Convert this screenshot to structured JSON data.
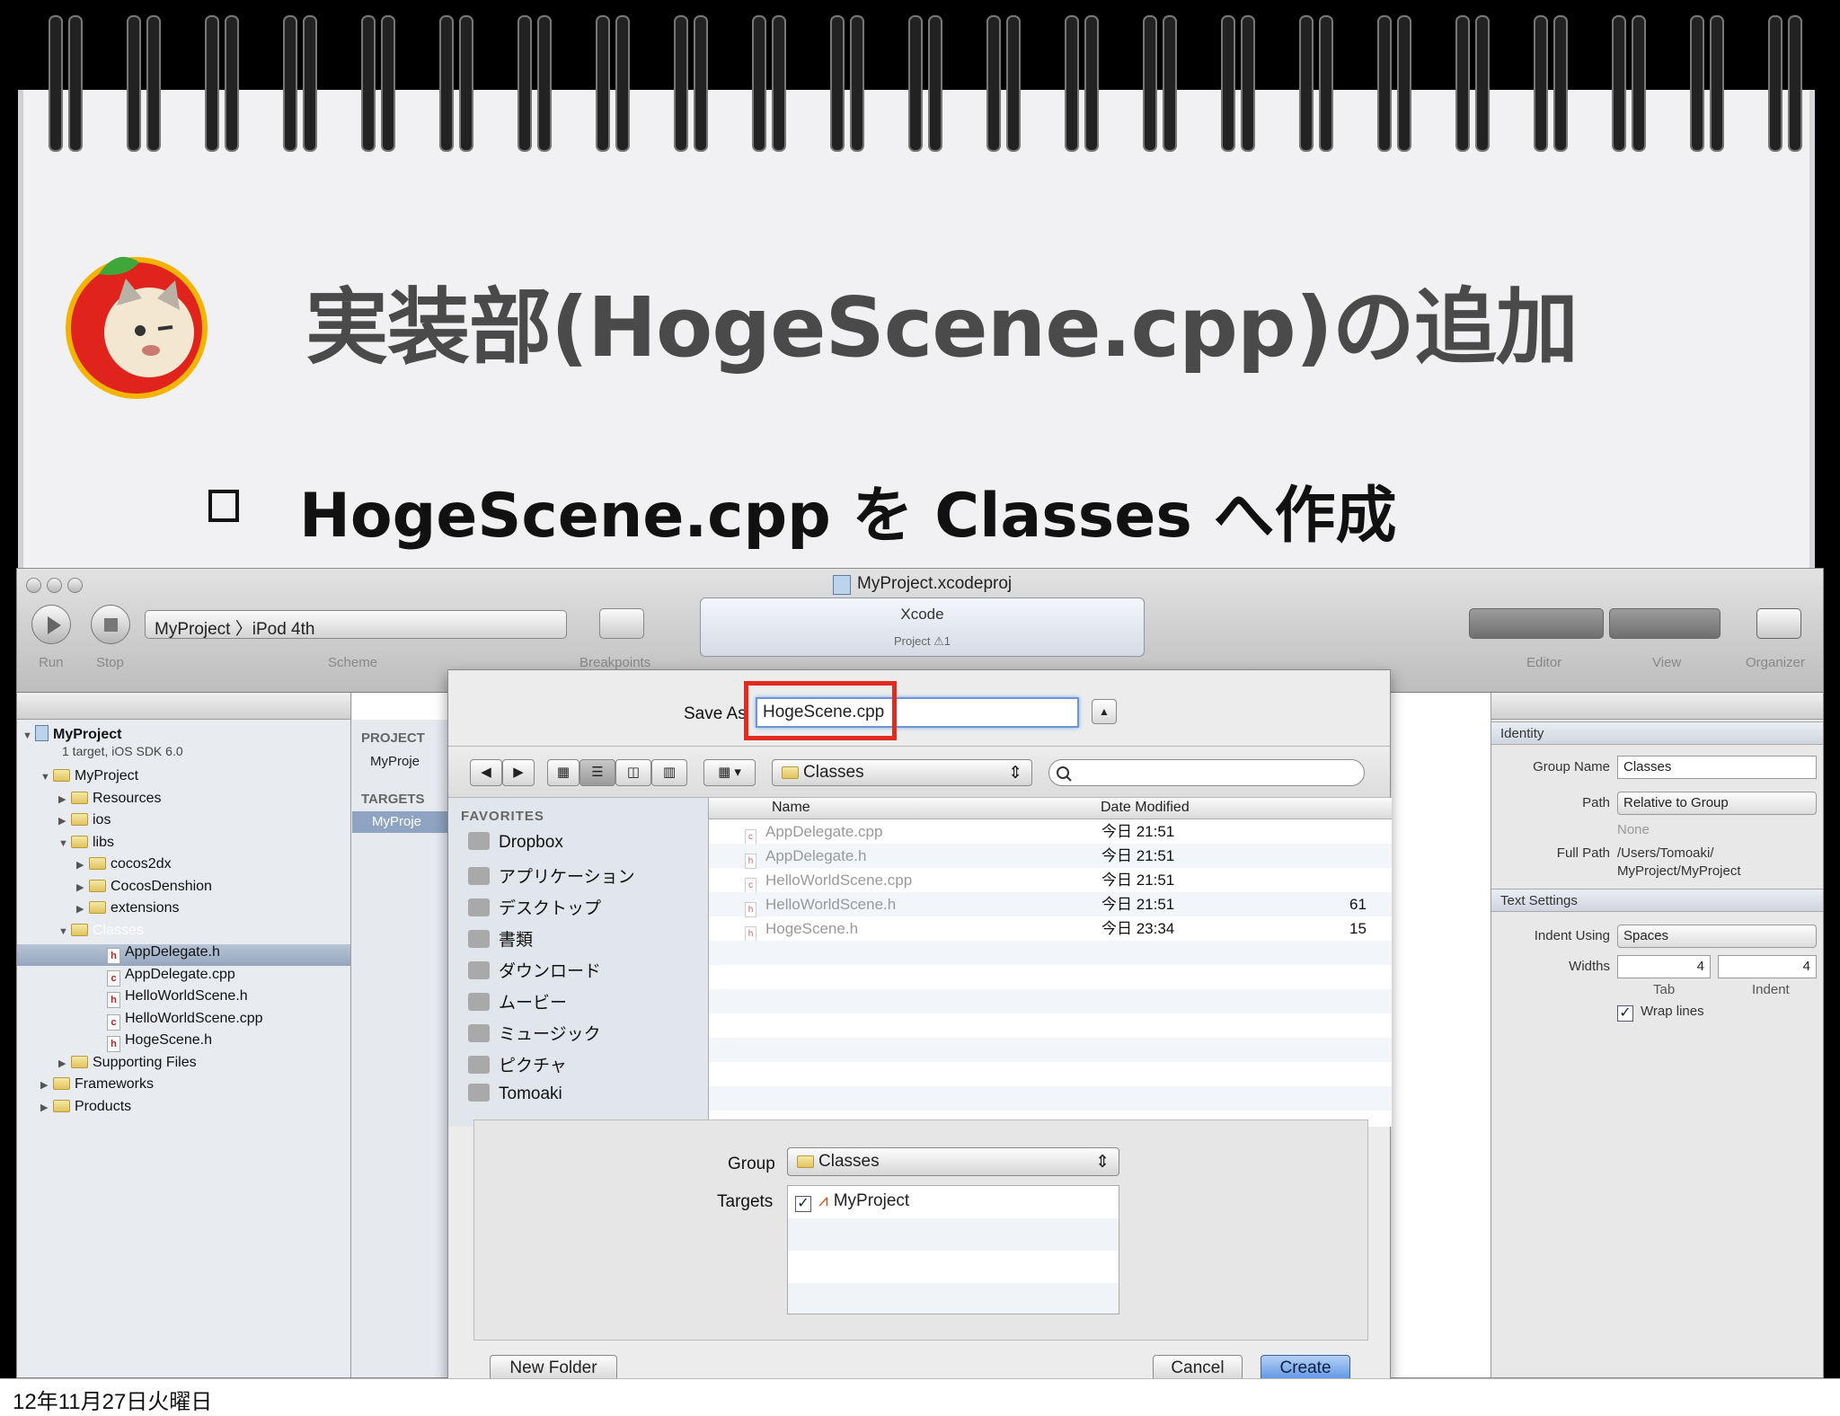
{
  "slide": {
    "title": "実装部(HogeScene.cpp)の追加",
    "bullet": "HogeScene.cpp を Classes へ作成",
    "footer_date": "12年11月27日火曜日"
  },
  "xcode": {
    "window_title": "MyProject.xcodeproj",
    "toolbar": {
      "run_label": "Run",
      "stop_label": "Stop",
      "scheme_label": "Scheme",
      "scheme_value": "MyProject 〉iPod 4th",
      "breakpoints_label": "Breakpoints",
      "editor_label": "Editor",
      "view_label": "View",
      "organizer_label": "Organizer"
    },
    "activity": {
      "title": "Xcode",
      "status": "Project ⚠1"
    },
    "navigator": {
      "project_name": "MyProject",
      "project_sub": "1 target, iOS SDK 6.0",
      "items": [
        {
          "label": "MyProject",
          "kind": "folder"
        },
        {
          "label": "Resources",
          "kind": "folder"
        },
        {
          "label": "ios",
          "kind": "folder"
        },
        {
          "label": "libs",
          "kind": "folder"
        },
        {
          "label": "cocos2dx",
          "kind": "folder"
        },
        {
          "label": "CocosDenshion",
          "kind": "folder"
        },
        {
          "label": "extensions",
          "kind": "folder"
        },
        {
          "label": "Classes",
          "kind": "folder"
        },
        {
          "label": "AppDelegate.h",
          "kind": "h"
        },
        {
          "label": "AppDelegate.cpp",
          "kind": "cpp"
        },
        {
          "label": "HelloWorldScene.h",
          "kind": "h"
        },
        {
          "label": "HelloWorldScene.cpp",
          "kind": "cpp"
        },
        {
          "label": "HogeScene.h",
          "kind": "h"
        },
        {
          "label": "Supporting Files",
          "kind": "folder"
        },
        {
          "label": "Frameworks",
          "kind": "folder"
        },
        {
          "label": "Products",
          "kind": "folder"
        }
      ]
    },
    "project_panel": {
      "project_header": "PROJECT",
      "project_item": "MyProje",
      "targets_header": "TARGETS",
      "target_item": "MyProje"
    },
    "inspector": {
      "identity_header": "Identity",
      "group_name_label": "Group Name",
      "group_name_value": "Classes",
      "path_label": "Path",
      "path_value": "Relative to Group",
      "path_none": "None",
      "full_path_label": "Full Path",
      "full_path_value_1": "/Users/Tomoaki/",
      "full_path_value_2": "MyProject/MyProject",
      "text_settings_header": "Text Settings",
      "indent_using_label": "Indent Using",
      "indent_using_value": "Spaces",
      "widths_label": "Widths",
      "tab_value": "4",
      "indent_value": "4",
      "tab_label": "Tab",
      "indent_label": "Indent",
      "wrap_lines_label": "Wrap lines"
    }
  },
  "save_dialog": {
    "save_as_label": "Save As",
    "save_as_value": "HogeScene.cpp",
    "location": "Classes",
    "favorites_header": "FAVORITES",
    "favorites": [
      "Dropbox",
      "アプリケーション",
      "デスクトップ",
      "書類",
      "ダウンロード",
      "ムービー",
      "ミュージック",
      "ピクチャ",
      "Tomoaki"
    ],
    "columns": {
      "name": "Name",
      "date": "Date Modified"
    },
    "files": [
      {
        "name": "AppDelegate.cpp",
        "date": "今日 21:51",
        "size": ""
      },
      {
        "name": "AppDelegate.h",
        "date": "今日 21:51",
        "size": ""
      },
      {
        "name": "HelloWorldScene.cpp",
        "date": "今日 21:51",
        "size": ""
      },
      {
        "name": "HelloWorldScene.h",
        "date": "今日 21:51",
        "size": "61"
      },
      {
        "name": "HogeScene.h",
        "date": "今日 23:34",
        "size": "15"
      }
    ],
    "group_label": "Group",
    "group_value": "Classes",
    "targets_label": "Targets",
    "target_value": "MyProject",
    "new_folder_label": "New Folder",
    "cancel_label": "Cancel",
    "create_label": "Create"
  },
  "colors": {
    "highlight": "#e32a1e",
    "accent": "#5a92e2"
  }
}
